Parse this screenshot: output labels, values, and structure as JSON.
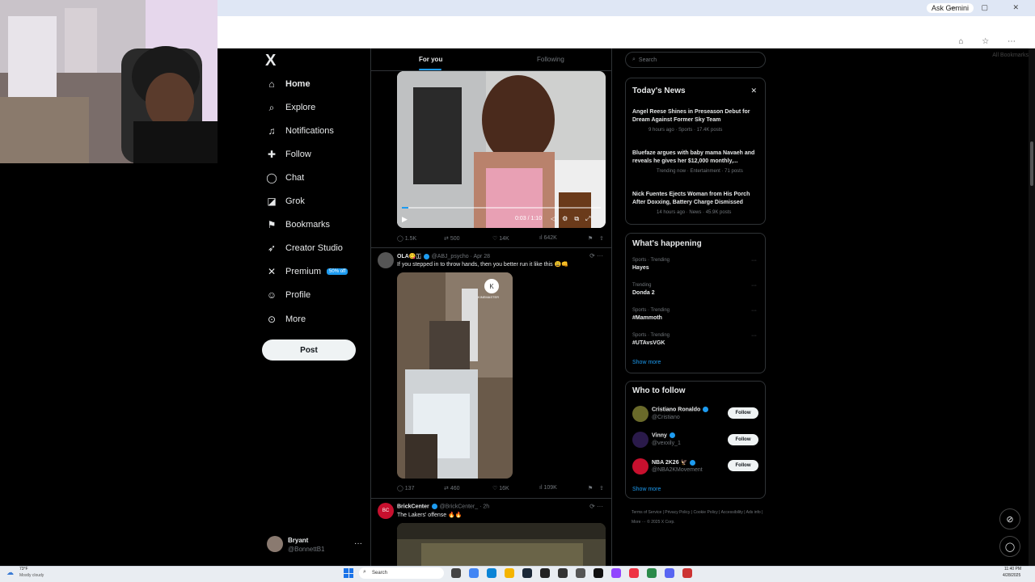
{
  "browser": {
    "ask_gemini": "Ask Gemini",
    "window_controls": "— ▢ ✕",
    "all_bookmarks": "All Bookmarks",
    "profile_initial": "B"
  },
  "nav": {
    "logo": "X",
    "items": [
      {
        "label": "Home",
        "icon": "home-icon",
        "glyph": "⌂"
      },
      {
        "label": "Explore",
        "icon": "search-icon",
        "glyph": "⌕"
      },
      {
        "label": "Notifications",
        "icon": "bell-icon",
        "glyph": "🔔"
      },
      {
        "label": "Follow",
        "icon": "add-user-icon",
        "glyph": "👤"
      },
      {
        "label": "Chat",
        "icon": "chat-icon",
        "glyph": "◯"
      },
      {
        "label": "Grok",
        "icon": "grok-icon",
        "glyph": "◪"
      },
      {
        "label": "Bookmarks",
        "icon": "bookmark-icon",
        "glyph": "⚑"
      },
      {
        "label": "Creator Studio",
        "icon": "rocket-icon",
        "glyph": "➶"
      },
      {
        "label": "Premium",
        "icon": "x-premium-icon",
        "glyph": "✕"
      },
      {
        "label": "Profile",
        "icon": "person-icon",
        "glyph": "☺"
      },
      {
        "label": "More",
        "icon": "more-circle-icon",
        "glyph": "⊙"
      }
    ],
    "premium_badge": "50% off",
    "post_button": "Post"
  },
  "account": {
    "name": "Bryant",
    "handle": "@BonnettB1",
    "more": "···"
  },
  "feed": {
    "tabs": {
      "for_you": "For you",
      "following": "Following"
    },
    "video1": {
      "time": "0:03 / 1:10"
    },
    "tweet0_actions": {
      "replies": "1.5K",
      "reposts": "500",
      "likes": "14K",
      "views": "642K"
    },
    "tweet1": {
      "name": "OLA😋🇮",
      "handle": "@ABJ_psycho · Apr 28",
      "text": "If you stepped in to throw hands, then you better run it like this 😩👊",
      "watermark": "KINEMASTER",
      "actions": {
        "replies": "137",
        "reposts": "460",
        "likes": "16K",
        "views": "109K"
      }
    },
    "tweet2": {
      "name": "BrickCenter",
      "handle": "@BrickCenter_ · 2h",
      "text": "The Lakers' offense 🔥🔥"
    }
  },
  "right": {
    "search_placeholder": "Search",
    "news": {
      "title": "Today's News",
      "close": "✕",
      "items": [
        {
          "title": "Angel Reese Shines in Preseason Debut for Dream Against Former Sky Team",
          "meta": "9 hours ago · Sports · 17.4K posts"
        },
        {
          "title": "Bluefaze argues with baby mama Navaeh and reveals he gives her $12,000 monthly,...",
          "meta": "Trending now · Entertainment · 71 posts"
        },
        {
          "title": "Nick Fuentes Ejects Woman from His Porch After Doxxing, Battery Charge Dismissed",
          "meta": "14 hours ago · News · 45.9K posts"
        }
      ]
    },
    "happening": {
      "title": "What's happening",
      "trends": [
        {
          "cat": "Sports · Trending",
          "name": "Hayes"
        },
        {
          "cat": "Trending",
          "name": "Donda 2"
        },
        {
          "cat": "Sports · Trending",
          "name": "#Mammoth"
        },
        {
          "cat": "Sports · Trending",
          "name": "#UTAvsVGK"
        }
      ],
      "show_more": "Show more"
    },
    "who_to_follow": {
      "title": "Who to follow",
      "accounts": [
        {
          "name": "Cristiano Ronaldo",
          "handle": "@Cristiano",
          "color": "#6a6a2a"
        },
        {
          "name": "Vinny",
          "handle": "@vexxily_1",
          "color": "#2a1a4a"
        },
        {
          "name": "NBA 2K26 🦅",
          "handle": "@NBA2KMovement",
          "color": "#c8102e"
        }
      ],
      "follow_label": "Follow",
      "show_more": "Show more"
    },
    "footer": "Terms of Service  |  Privacy Policy  |  Cookie Policy  |  Accessibility  |  Ads info  |  More ···  © 2025 X Corp."
  },
  "taskbar": {
    "temp": "73°F",
    "weather": "Mostly cloudy",
    "search": "Search",
    "time": "11:40 PM",
    "date": "4/28/2025"
  },
  "colors": {
    "accent": "#1d9bf0",
    "background": "#000000",
    "border": "#2f3336",
    "muted": "#71767b"
  }
}
